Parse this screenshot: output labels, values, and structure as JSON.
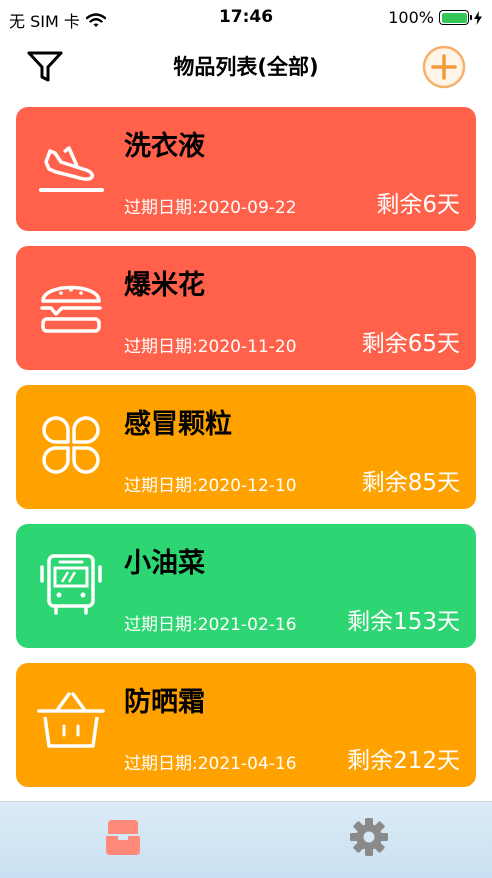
{
  "status_bar": {
    "carrier": "无 SIM 卡",
    "time": "17:46",
    "battery": "100%"
  },
  "nav": {
    "title": "物品列表(全部)",
    "filter_icon": "filter-icon",
    "add_icon": "plus-circle-icon"
  },
  "items": [
    {
      "name": "洗衣液",
      "date_text": "过期日期:2020-09-22",
      "remaining_text": "剩余6天",
      "color": "#FF614A",
      "icon": "airplane-landing-icon"
    },
    {
      "name": "爆米花",
      "date_text": "过期日期:2020-11-20",
      "remaining_text": "剩余65天",
      "color": "#FF614A",
      "icon": "burger-icon"
    },
    {
      "name": "感冒颗粒",
      "date_text": "过期日期:2020-12-10",
      "remaining_text": "剩余85天",
      "color": "#FFA200",
      "icon": "clover-icon"
    },
    {
      "name": "小油菜",
      "date_text": "过期日期:2021-02-16",
      "remaining_text": "剩余153天",
      "color": "#2ED573",
      "icon": "bus-icon"
    },
    {
      "name": "防晒霜",
      "date_text": "过期日期:2021-04-16",
      "remaining_text": "剩余212天",
      "color": "#FFA200",
      "icon": "basket-icon"
    }
  ],
  "tab_bar": {
    "tabs": [
      {
        "icon": "box-icon",
        "active": true,
        "color": "#FF8A7A"
      },
      {
        "icon": "gear-icon",
        "active": false,
        "color": "#8A8A8A"
      }
    ]
  }
}
